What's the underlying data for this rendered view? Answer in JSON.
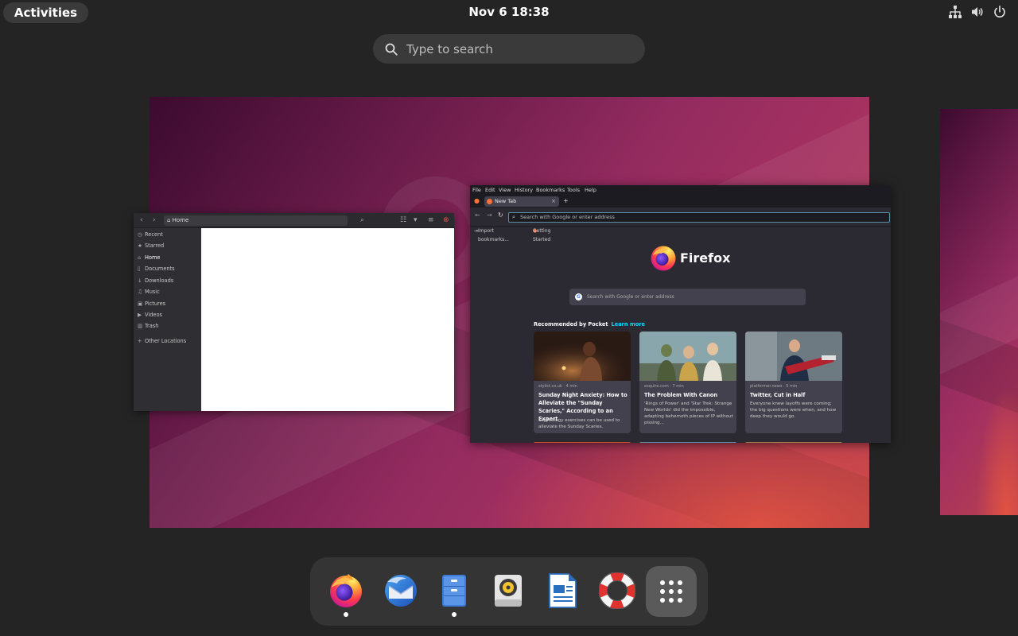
{
  "topbar": {
    "activities_label": "Activities",
    "clock": "Nov 6  18:38",
    "tray_icons": [
      "network-icon",
      "volume-icon",
      "power-icon"
    ]
  },
  "search": {
    "placeholder": "Type to search"
  },
  "files_window": {
    "path": "Home",
    "sidebar": [
      {
        "icon": "clock-icon",
        "label": "Recent"
      },
      {
        "icon": "star-icon",
        "label": "Starred"
      },
      {
        "icon": "home-icon",
        "label": "Home"
      },
      {
        "icon": "document-icon",
        "label": "Documents"
      },
      {
        "icon": "download-icon",
        "label": "Downloads"
      },
      {
        "icon": "music-icon",
        "label": "Music"
      },
      {
        "icon": "picture-icon",
        "label": "Pictures"
      },
      {
        "icon": "video-icon",
        "label": "Videos"
      },
      {
        "icon": "trash-icon",
        "label": "Trash"
      },
      {
        "icon": "plus-icon",
        "label": "Other Locations"
      }
    ]
  },
  "firefox_window": {
    "menu": [
      "File",
      "Edit",
      "View",
      "History",
      "Bookmarks",
      "Tools",
      "Help"
    ],
    "tab_title": "New Tab",
    "url_placeholder": "Search with Google or enter address",
    "bookmarks": [
      "Import bookmarks...",
      "Getting Started"
    ],
    "brand": "Firefox",
    "search_placeholder": "Search with Google or enter address",
    "pocket_heading": "Recommended by Pocket",
    "learn_more": "Learn more",
    "cards": [
      {
        "source": "stylist.co.uk · 4 min",
        "title": "Sunday Night Anxiety: How to Alleviate the \"Sunday Scaries,\" According to an Expert",
        "excerpt": "Sophrology exercises can be used to alleviate the Sunday Scaries."
      },
      {
        "source": "esquire.com · 7 min",
        "title": "The Problem With Canon",
        "excerpt": "'Rings of Power' and 'Star Trek: Strange New Worlds' did the impossible, adapting behemoth pieces of IP without pissing..."
      },
      {
        "source": "platformer.news · 5 min",
        "title": "Twitter, Cut in Half",
        "excerpt": "Everyone knew layoffs were coming; the big questions were when, and how deep they would go."
      }
    ]
  },
  "dock": {
    "apps": [
      {
        "name": "Firefox",
        "icon": "firefox-icon",
        "running": true
      },
      {
        "name": "Thunderbird",
        "icon": "thunderbird-icon",
        "running": false
      },
      {
        "name": "Files",
        "icon": "files-icon",
        "running": true
      },
      {
        "name": "Rhythmbox",
        "icon": "rhythmbox-icon",
        "running": false
      },
      {
        "name": "LibreOffice Writer",
        "icon": "writer-icon",
        "running": false
      },
      {
        "name": "Help",
        "icon": "help-icon",
        "running": false
      }
    ],
    "show_apps_icon": "app-grid-icon"
  },
  "colors": {
    "panel": "#242424",
    "pill": "#3a3a3a",
    "dock": "#343434",
    "wallpaper_dark": "#3c0b2f",
    "wallpaper_mid": "#932b5f",
    "wallpaper_warm": "#e85640",
    "firefox_accent": "#00ddff"
  }
}
